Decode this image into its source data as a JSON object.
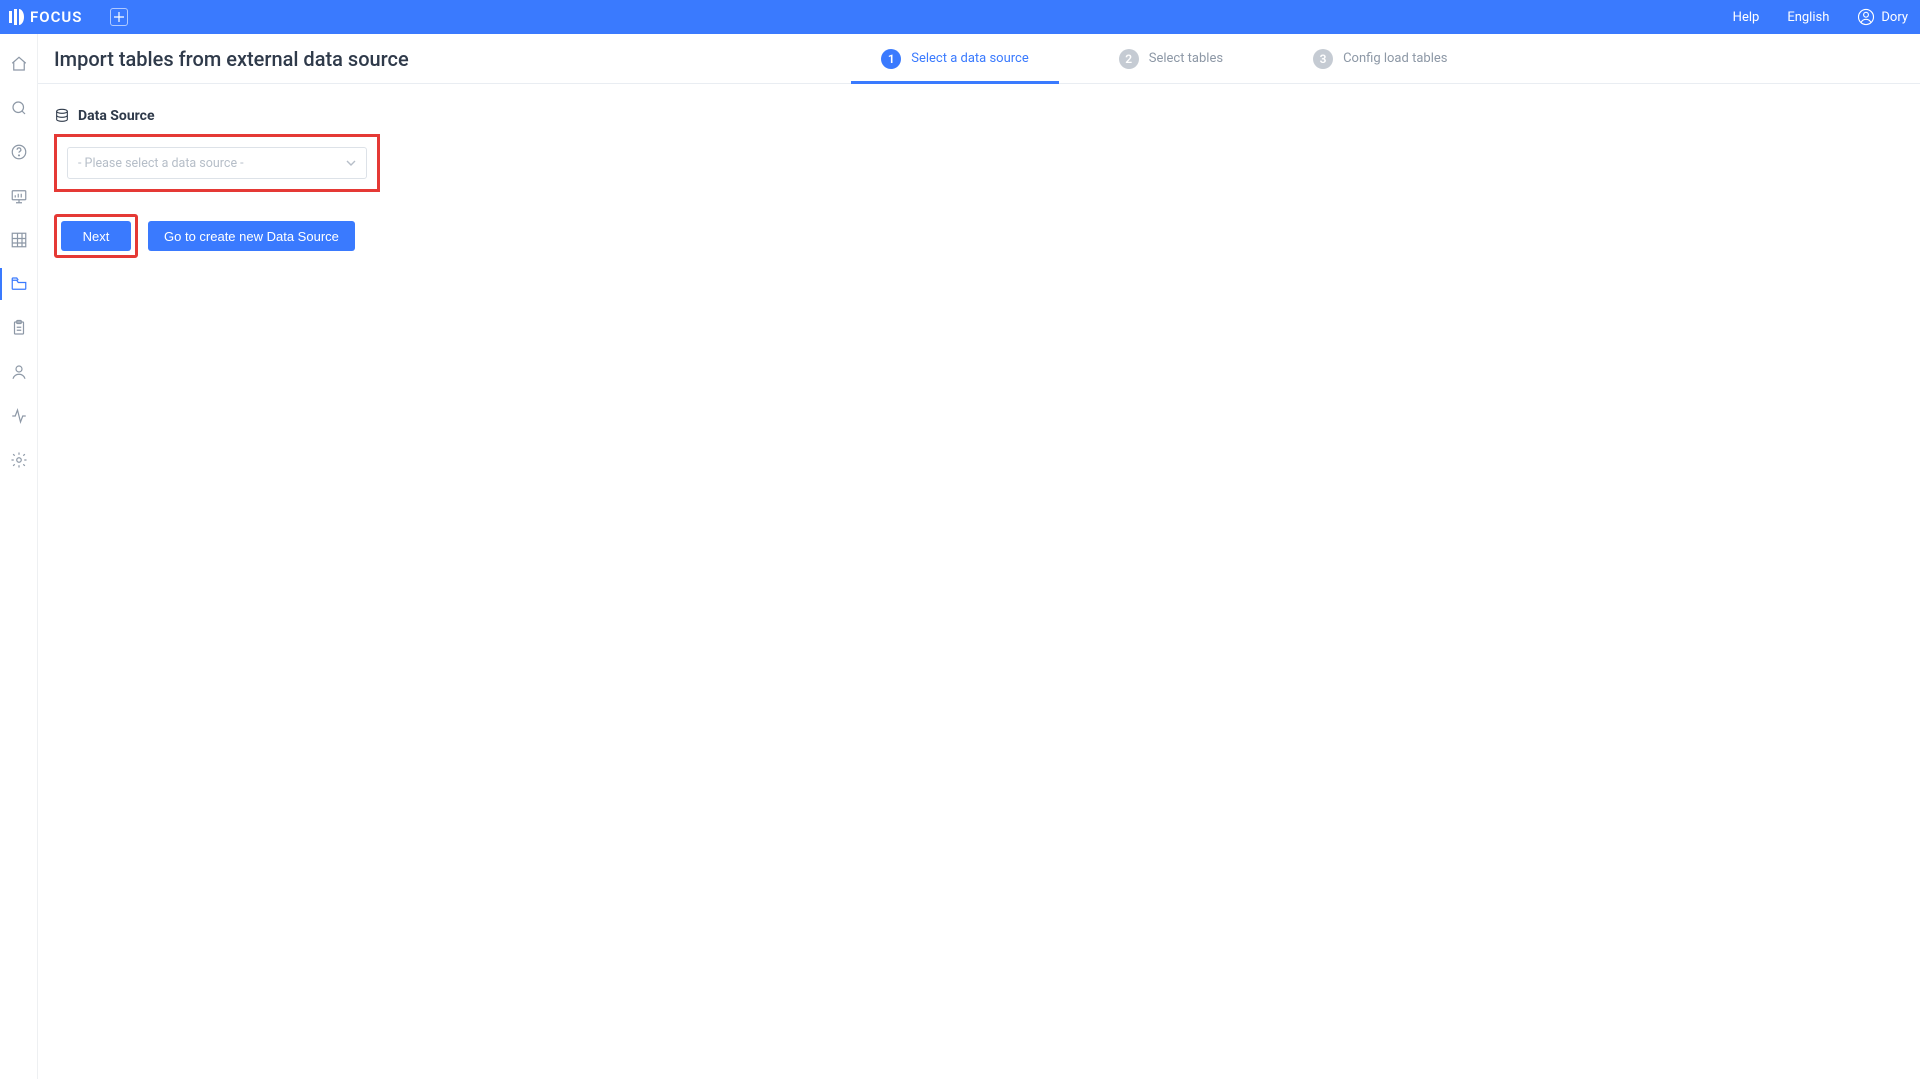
{
  "topbar": {
    "brand": "FOCUS",
    "help": "Help",
    "language": "English",
    "user": "Dory"
  },
  "sidenav": {
    "items": [
      {
        "name": "home-icon"
      },
      {
        "name": "search-icon"
      },
      {
        "name": "question-icon"
      },
      {
        "name": "dashboard-icon"
      },
      {
        "name": "grid-icon"
      },
      {
        "name": "folder-icon",
        "active": true
      },
      {
        "name": "clipboard-icon"
      },
      {
        "name": "user-icon"
      },
      {
        "name": "activity-icon"
      },
      {
        "name": "gear-icon"
      }
    ]
  },
  "page": {
    "title": "Import tables from external data source",
    "steps": [
      {
        "num": "1",
        "label": "Select a data source",
        "active": true
      },
      {
        "num": "2",
        "label": "Select tables",
        "active": false
      },
      {
        "num": "3",
        "label": "Config load tables",
        "active": false
      }
    ]
  },
  "form": {
    "section_label": "Data Source",
    "select_placeholder": "- Please select a data source -",
    "next_label": "Next",
    "create_label": "Go to create new Data Source"
  }
}
